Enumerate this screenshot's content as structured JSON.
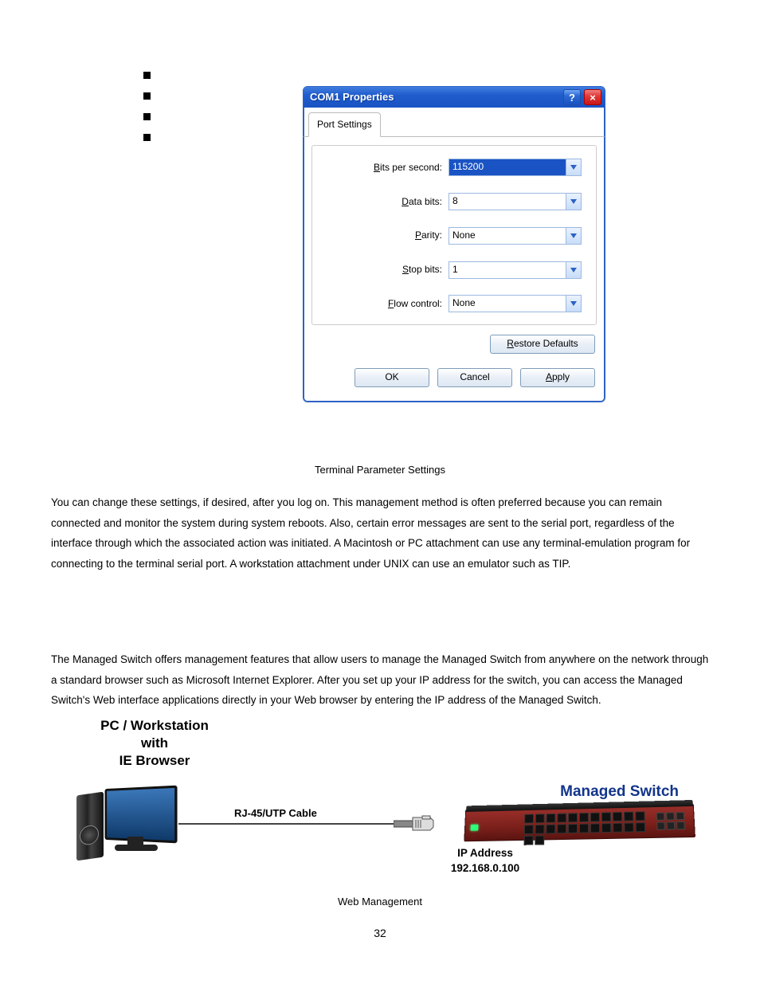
{
  "dialog": {
    "title": "COM1 Properties",
    "tab": "Port Settings",
    "fields": {
      "bps_label_pre": "B",
      "bps_label_post": "its per second:",
      "data_label_pre": "D",
      "data_label_post": "ata bits:",
      "parity_label_pre": "P",
      "parity_label_post": "arity:",
      "stop_label_pre": "S",
      "stop_label_post": "top bits:",
      "flow_label_pre": "F",
      "flow_label_post": "low control:",
      "bps_value": "115200",
      "data_value": "8",
      "parity_value": "None",
      "stop_value": "1",
      "flow_value": "None"
    },
    "restore_btn_pre": "R",
    "restore_btn_post": "estore Defaults",
    "ok_btn": "OK",
    "cancel_btn": "Cancel",
    "apply_btn_pre": "A",
    "apply_btn_post": "pply",
    "help_glyph": "?",
    "close_glyph": "×"
  },
  "captions": {
    "terminal": "Terminal Parameter Settings",
    "web": "Web Management"
  },
  "paragraphs": {
    "p1": "You can change these settings, if desired, after you log on. This management method is often preferred because you can remain connected and monitor the system during system reboots. Also, certain error messages are sent to the serial port, regardless of the interface through which the associated action was initiated. A Macintosh or PC attachment can use any terminal-emulation program for connecting to the terminal serial port. A workstation attachment under UNIX can use an emulator such as TIP.",
    "p2": "The Managed Switch offers management features that allow users to manage the Managed Switch from anywhere on the network through a standard browser such as Microsoft Internet Explorer. After you set up your IP address for the switch, you can access the Managed Switch's Web interface applications directly in your Web browser by entering the IP address of the Managed Switch."
  },
  "figure": {
    "pc_label_l1": "PC / Workstation",
    "pc_label_l2": "with",
    "pc_label_l3": "IE Browser",
    "cable_label": "RJ-45/UTP Cable",
    "switch_label": "Managed Switch",
    "ip_label_l1": "IP Address",
    "ip_label_l2": "192.168.0.100"
  },
  "page_number": "32"
}
